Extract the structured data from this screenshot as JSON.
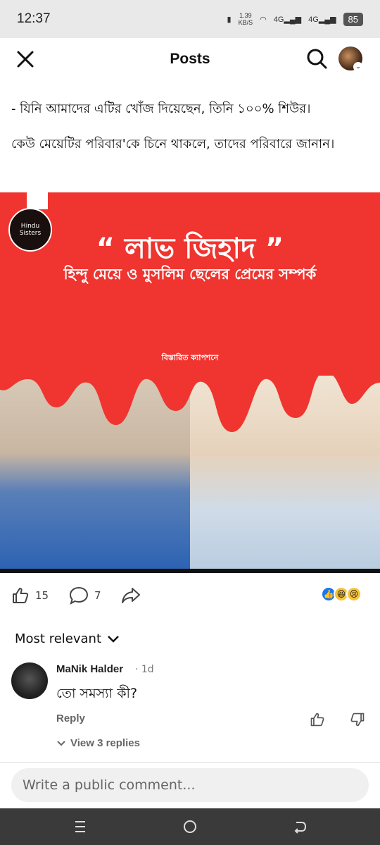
{
  "status": {
    "time": "12:37",
    "speed": "1.39\nKB/S",
    "net1": "4G",
    "net2": "4G",
    "battery": "85"
  },
  "appbar": {
    "title": "Posts"
  },
  "post": {
    "line1": "- যিনি আমাদের এটির খোঁজ দিয়েছেন, তিনি ১০০% শিউর।",
    "line2": "কেউ মেয়েটির পরিবার'কে চিনে থাকলে, তাদের পরিবারে জানান।"
  },
  "image": {
    "logo_text": "Hindu Sisters",
    "headline": "“ লাভ জিহাদ ”",
    "subline": "হিন্দু মেয়ে ও মুসলিম ছেলের প্রেমের সম্পর্ক",
    "caption_hint": "বিস্তারিত ক্যাপশনে"
  },
  "actions": {
    "likes": "15",
    "comments": "7"
  },
  "sort": {
    "label": "Most relevant"
  },
  "comment": {
    "author": "MaNik Halder",
    "time": "· 1d",
    "text": "তো সমস্যা কী?",
    "reply": "Reply",
    "view_replies": "View 3 replies"
  },
  "composer": {
    "placeholder": "Write a public comment..."
  },
  "colors": {
    "poster_red": "#f0342f",
    "like_blue": "#1877f2"
  }
}
